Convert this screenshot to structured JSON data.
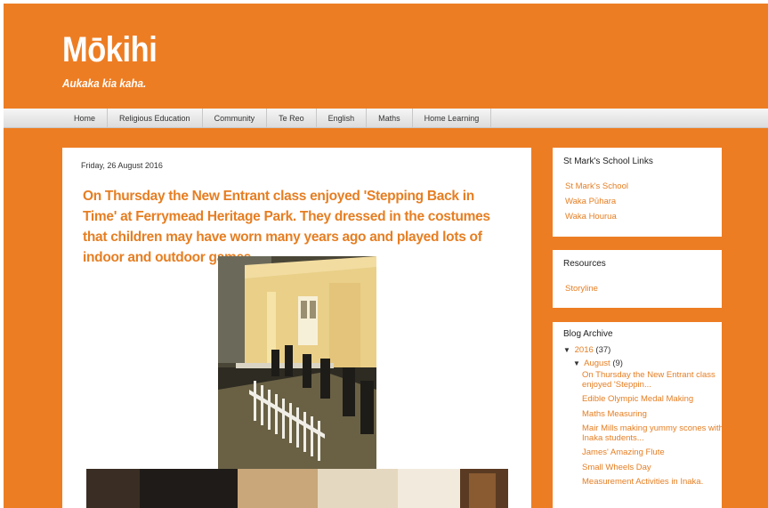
{
  "header": {
    "title": "Mōkihi",
    "description": "Aukaka kia kaha."
  },
  "nav": {
    "tabs": [
      "Home",
      "Religious Education",
      "Community",
      "Te Reo",
      "English",
      "Maths",
      "Home Learning"
    ]
  },
  "post": {
    "date": "Friday, 26 August 2016",
    "title": "On Thursday the New Entrant class enjoyed 'Stepping Back in Time' at Ferrymead Heritage Park. They dressed in the costumes that children may have worn many years ago and played lots of indoor and outdoor games."
  },
  "sidebar": {
    "school_links": {
      "title": "St Mark's School Links",
      "links": [
        "St Mark's School",
        "Waka Pūhara",
        "Waka Hourua"
      ]
    },
    "resources": {
      "title": "Resources",
      "links": [
        "Storyline"
      ]
    },
    "archive": {
      "title": "Blog Archive",
      "year_arrow": "▼",
      "year": "2016",
      "year_count": "(37)",
      "month_arrow": "▼",
      "month": "August",
      "month_count": "(9)",
      "posts": [
        "On Thursday the New Entrant class enjoyed 'Steppin...",
        "Edible Olympic Medal Making",
        "Maths Measuring",
        "Mair Mills making yummy scones with Inaka students...",
        "James' Amazing Flute",
        "Small Wheels Day",
        "Measurement Activities in Inaka."
      ]
    }
  },
  "colors": {
    "background": "#ed7d23",
    "accent": "#e67e22",
    "tab_bar": "#e8e8e8"
  }
}
